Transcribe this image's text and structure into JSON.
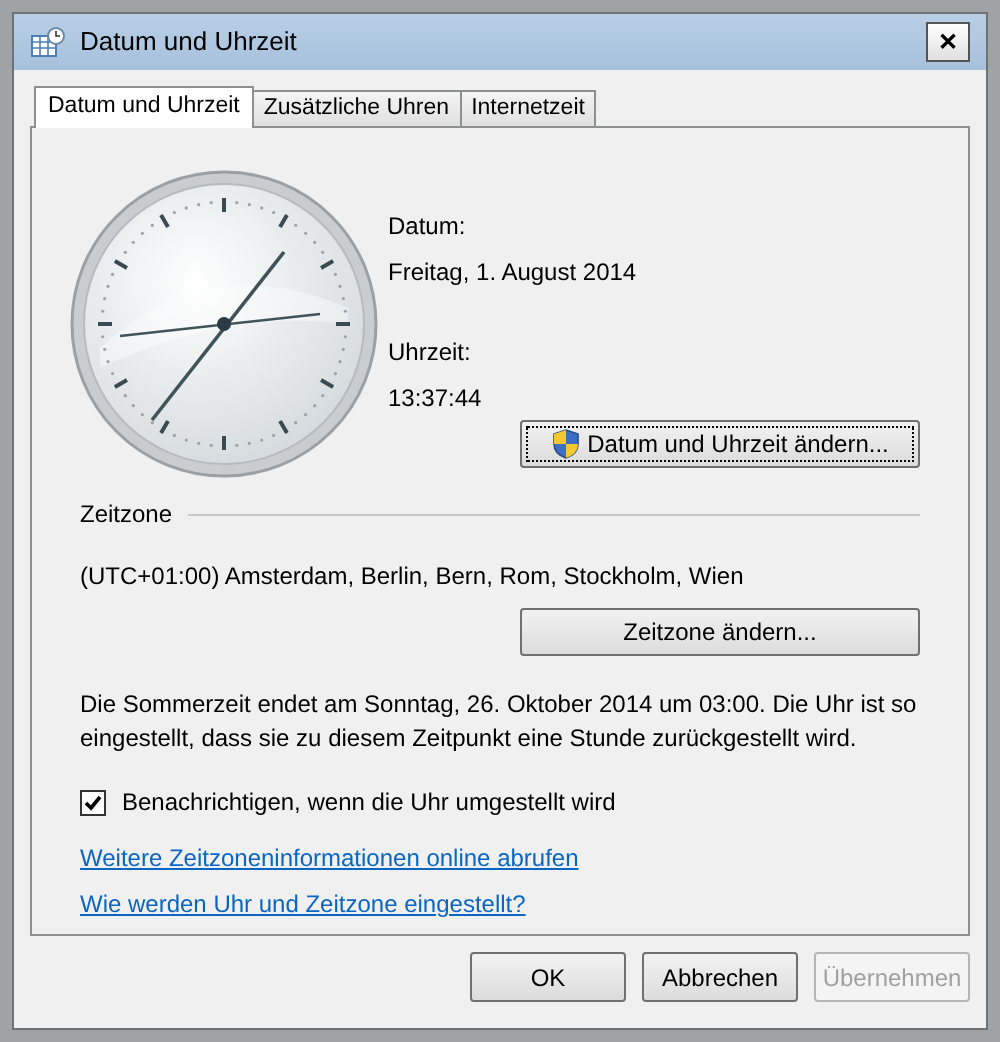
{
  "window": {
    "title": "Datum und Uhrzeit",
    "close": "✕"
  },
  "tabs": [
    {
      "label": "Datum und Uhrzeit",
      "selected": true
    },
    {
      "label": "Zusätzliche Uhren",
      "selected": false
    },
    {
      "label": "Internetzeit",
      "selected": false
    }
  ],
  "date": {
    "label": "Datum:",
    "value": "Freitag, 1. August 2014"
  },
  "time": {
    "label": "Uhrzeit:",
    "value": "13:37:44"
  },
  "change_datetime_button": "Datum und Uhrzeit ändern...",
  "timezone": {
    "heading": "Zeitzone",
    "value": "(UTC+01:00) Amsterdam, Berlin, Bern, Rom, Stockholm, Wien",
    "button": "Zeitzone ändern..."
  },
  "dst_note": "Die Sommerzeit endet am Sonntag, 26. Oktober 2014 um 03:00. Die Uhr ist so eingestellt, dass sie zu diesem Zeitpunkt eine Stunde zurückgestellt wird.",
  "notify": {
    "label": "Benachrichtigen, wenn die Uhr umgestellt wird",
    "checked": true
  },
  "links": [
    "Weitere Zeitzoneninformationen online abrufen",
    "Wie werden Uhr und Zeitzone eingestellt?"
  ],
  "buttons": [
    {
      "label": "OK",
      "disabled": false
    },
    {
      "label": "Abbrechen",
      "disabled": false
    },
    {
      "label": "Übernehmen",
      "disabled": true
    }
  ]
}
